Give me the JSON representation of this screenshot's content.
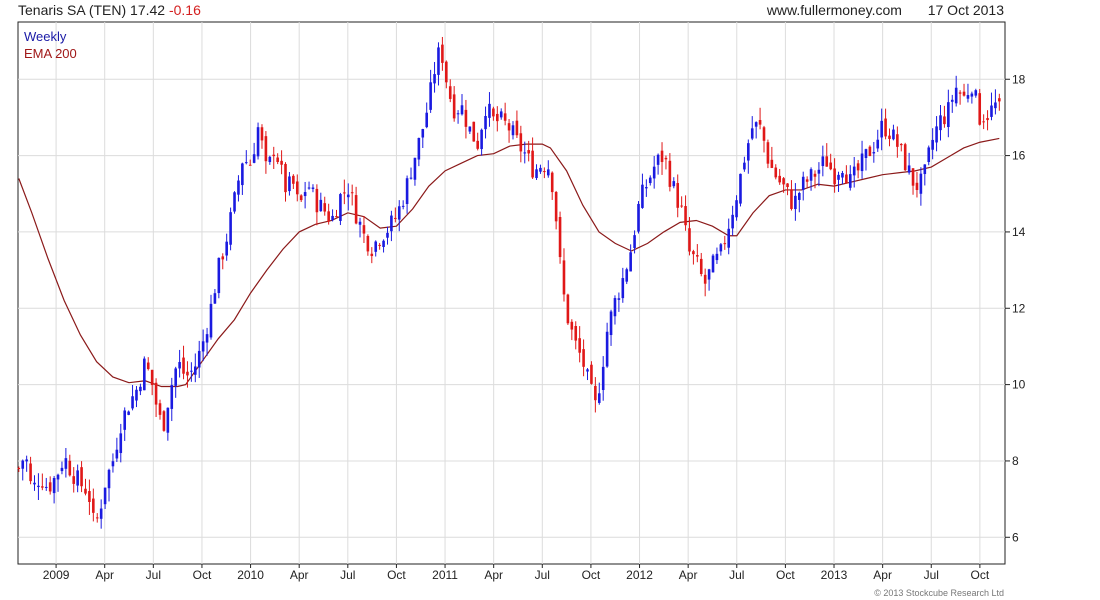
{
  "header": {
    "title": "Tenaris SA (TEN)",
    "price": "17.42",
    "change": "-0.16",
    "site": "www.fullermoney.com",
    "date": "17 Oct 2013"
  },
  "footer": {
    "credit": "© 2013 Stockcube Research Ltd"
  },
  "chart_data": {
    "type": "candlestick",
    "legend": [
      "Weekly",
      "EMA 200"
    ],
    "colors": {
      "up": "#1a1ae0",
      "down": "#e01818",
      "ema": "#8b1a1a",
      "grid": "#dcdcdc"
    },
    "grid": true,
    "ylim": [
      5.3,
      19.5
    ],
    "yticks": [
      6,
      8,
      10,
      12,
      14,
      16,
      18
    ],
    "xticks": [
      {
        "label": "2009",
        "t": 1.0
      },
      {
        "label": "Apr",
        "t": 4.0
      },
      {
        "label": "Jul",
        "t": 7.0
      },
      {
        "label": "Oct",
        "t": 10.0
      },
      {
        "label": "2010",
        "t": 13.0
      },
      {
        "label": "Apr",
        "t": 16.0
      },
      {
        "label": "Jul",
        "t": 19.0
      },
      {
        "label": "Oct",
        "t": 22.0
      },
      {
        "label": "2011",
        "t": 25.0
      },
      {
        "label": "Apr",
        "t": 28.0
      },
      {
        "label": "Jul",
        "t": 31.0
      },
      {
        "label": "Oct",
        "t": 34.0
      },
      {
        "label": "2012",
        "t": 37.0
      },
      {
        "label": "Apr",
        "t": 40.0
      },
      {
        "label": "Jul",
        "t": 43.0
      },
      {
        "label": "Oct",
        "t": 46.0
      },
      {
        "label": "2013",
        "t": 49.0
      },
      {
        "label": "Apr",
        "t": 52.0
      },
      {
        "label": "Jul",
        "t": 55.0
      },
      {
        "label": "Oct",
        "t": 58.0
      }
    ],
    "tRange": [
      -1.35,
      59.55
    ],
    "closes": [
      [
        -1.3,
        7.8
      ],
      [
        -0.9,
        8.2
      ],
      [
        -0.5,
        7.2
      ],
      [
        0.0,
        7.6
      ],
      [
        0.5,
        7.3
      ],
      [
        1.0,
        7.6
      ],
      [
        1.5,
        8.1
      ],
      [
        2.0,
        7.7
      ],
      [
        2.5,
        7.4
      ],
      [
        3.0,
        7.2
      ],
      [
        3.3,
        6.4
      ],
      [
        3.6,
        6.5
      ],
      [
        4.0,
        7.4
      ],
      [
        4.5,
        8.0
      ],
      [
        5.0,
        9.0
      ],
      [
        5.5,
        9.5
      ],
      [
        6.0,
        9.9
      ],
      [
        6.5,
        10.6
      ],
      [
        7.0,
        9.9
      ],
      [
        7.3,
        9.2
      ],
      [
        7.6,
        8.9
      ],
      [
        8.0,
        9.8
      ],
      [
        8.5,
        10.6
      ],
      [
        9.0,
        10.2
      ],
      [
        9.5,
        10.4
      ],
      [
        10.0,
        11.0
      ],
      [
        10.5,
        11.9
      ],
      [
        11.0,
        13.0
      ],
      [
        11.5,
        13.8
      ],
      [
        12.0,
        14.8
      ],
      [
        12.5,
        15.9
      ],
      [
        13.0,
        15.8
      ],
      [
        13.5,
        16.8
      ],
      [
        14.0,
        15.5
      ],
      [
        14.5,
        16.3
      ],
      [
        14.8,
        15.7
      ],
      [
        15.2,
        15.1
      ],
      [
        15.6,
        15.3
      ],
      [
        16.0,
        14.6
      ],
      [
        16.5,
        15.3
      ],
      [
        17.0,
        14.8
      ],
      [
        17.5,
        14.6
      ],
      [
        18.0,
        14.3
      ],
      [
        18.5,
        14.9
      ],
      [
        19.0,
        15.2
      ],
      [
        19.5,
        14.5
      ],
      [
        20.0,
        13.9
      ],
      [
        20.5,
        13.6
      ],
      [
        21.0,
        13.9
      ],
      [
        21.5,
        14.1
      ],
      [
        22.0,
        14.4
      ],
      [
        22.5,
        15.0
      ],
      [
        23.0,
        15.8
      ],
      [
        23.5,
        16.5
      ],
      [
        24.0,
        17.4
      ],
      [
        24.5,
        18.6
      ],
      [
        24.8,
        18.7
      ],
      [
        25.2,
        17.7
      ],
      [
        25.6,
        17.2
      ],
      [
        26.0,
        17.3
      ],
      [
        26.5,
        16.7
      ],
      [
        27.0,
        16.3
      ],
      [
        27.5,
        17.3
      ],
      [
        28.0,
        16.9
      ],
      [
        28.5,
        16.9
      ],
      [
        29.0,
        16.7
      ],
      [
        29.5,
        16.3
      ],
      [
        30.0,
        16.0
      ],
      [
        30.5,
        15.6
      ],
      [
        31.0,
        15.8
      ],
      [
        31.5,
        15.7
      ],
      [
        31.9,
        14.2
      ],
      [
        32.2,
        12.6
      ],
      [
        32.6,
        11.7
      ],
      [
        33.0,
        11.1
      ],
      [
        33.5,
        10.6
      ],
      [
        34.0,
        9.8
      ],
      [
        34.3,
        9.4
      ],
      [
        34.7,
        10.5
      ],
      [
        35.0,
        11.4
      ],
      [
        35.5,
        12.2
      ],
      [
        36.0,
        12.8
      ],
      [
        36.5,
        13.6
      ],
      [
        37.0,
        14.8
      ],
      [
        37.5,
        15.3
      ],
      [
        38.0,
        15.8
      ],
      [
        38.5,
        16.0
      ],
      [
        38.9,
        15.4
      ],
      [
        39.3,
        14.9
      ],
      [
        39.7,
        14.4
      ],
      [
        40.0,
        13.5
      ],
      [
        40.5,
        13.2
      ],
      [
        41.0,
        12.6
      ],
      [
        41.5,
        13.1
      ],
      [
        42.0,
        13.4
      ],
      [
        42.5,
        14.2
      ],
      [
        43.0,
        15.0
      ],
      [
        43.5,
        16.0
      ],
      [
        44.0,
        16.8
      ],
      [
        44.5,
        16.7
      ],
      [
        45.0,
        15.8
      ],
      [
        45.5,
        15.4
      ],
      [
        46.0,
        15.1
      ],
      [
        46.5,
        14.7
      ],
      [
        47.0,
        15.2
      ],
      [
        47.5,
        15.4
      ],
      [
        48.0,
        15.6
      ],
      [
        48.5,
        15.9
      ],
      [
        49.0,
        15.5
      ],
      [
        49.5,
        15.8
      ],
      [
        50.0,
        15.3
      ],
      [
        50.5,
        15.6
      ],
      [
        51.0,
        16.0
      ],
      [
        51.5,
        16.3
      ],
      [
        52.0,
        16.8
      ],
      [
        52.5,
        16.6
      ],
      [
        53.0,
        16.2
      ],
      [
        53.5,
        15.7
      ],
      [
        54.0,
        15.2
      ],
      [
        54.5,
        15.3
      ],
      [
        55.0,
        16.3
      ],
      [
        55.5,
        16.9
      ],
      [
        56.0,
        17.1
      ],
      [
        56.5,
        17.8
      ],
      [
        57.0,
        17.5
      ],
      [
        57.5,
        17.9
      ],
      [
        58.0,
        17.0
      ],
      [
        58.5,
        17.1
      ],
      [
        59.2,
        17.42
      ]
    ],
    "ema200": [
      [
        -1.3,
        15.4
      ],
      [
        -0.5,
        14.5
      ],
      [
        0.5,
        13.3
      ],
      [
        1.5,
        12.2
      ],
      [
        2.5,
        11.3
      ],
      [
        3.5,
        10.6
      ],
      [
        4.5,
        10.2
      ],
      [
        5.5,
        10.05
      ],
      [
        6.5,
        10.1
      ],
      [
        7.5,
        9.95
      ],
      [
        8.5,
        9.95
      ],
      [
        9.0,
        10.0
      ],
      [
        10.0,
        10.6
      ],
      [
        11.0,
        11.2
      ],
      [
        12.0,
        11.7
      ],
      [
        13.0,
        12.4
      ],
      [
        14.0,
        13.0
      ],
      [
        15.0,
        13.55
      ],
      [
        16.0,
        14.0
      ],
      [
        17.0,
        14.2
      ],
      [
        18.0,
        14.3
      ],
      [
        19.0,
        14.5
      ],
      [
        20.0,
        14.4
      ],
      [
        21.0,
        14.1
      ],
      [
        22.0,
        14.15
      ],
      [
        23.0,
        14.6
      ],
      [
        24.0,
        15.2
      ],
      [
        25.0,
        15.6
      ],
      [
        26.0,
        15.8
      ],
      [
        27.0,
        16.0
      ],
      [
        28.0,
        16.05
      ],
      [
        29.0,
        16.25
      ],
      [
        30.0,
        16.3
      ],
      [
        31.0,
        16.3
      ],
      [
        31.5,
        16.2
      ],
      [
        32.5,
        15.6
      ],
      [
        33.5,
        14.7
      ],
      [
        34.5,
        14.0
      ],
      [
        35.5,
        13.7
      ],
      [
        36.5,
        13.5
      ],
      [
        37.5,
        13.7
      ],
      [
        38.5,
        14.0
      ],
      [
        39.5,
        14.25
      ],
      [
        40.5,
        14.3
      ],
      [
        41.5,
        14.15
      ],
      [
        42.5,
        13.9
      ],
      [
        43.0,
        13.9
      ],
      [
        44.0,
        14.5
      ],
      [
        45.0,
        14.95
      ],
      [
        46.0,
        15.1
      ],
      [
        47.0,
        15.1
      ],
      [
        48.0,
        15.25
      ],
      [
        49.0,
        15.2
      ],
      [
        50.0,
        15.3
      ],
      [
        51.0,
        15.4
      ],
      [
        52.0,
        15.5
      ],
      [
        53.0,
        15.55
      ],
      [
        54.0,
        15.6
      ],
      [
        55.0,
        15.7
      ],
      [
        56.0,
        15.95
      ],
      [
        57.0,
        16.2
      ],
      [
        58.0,
        16.35
      ],
      [
        59.2,
        16.45
      ]
    ]
  }
}
